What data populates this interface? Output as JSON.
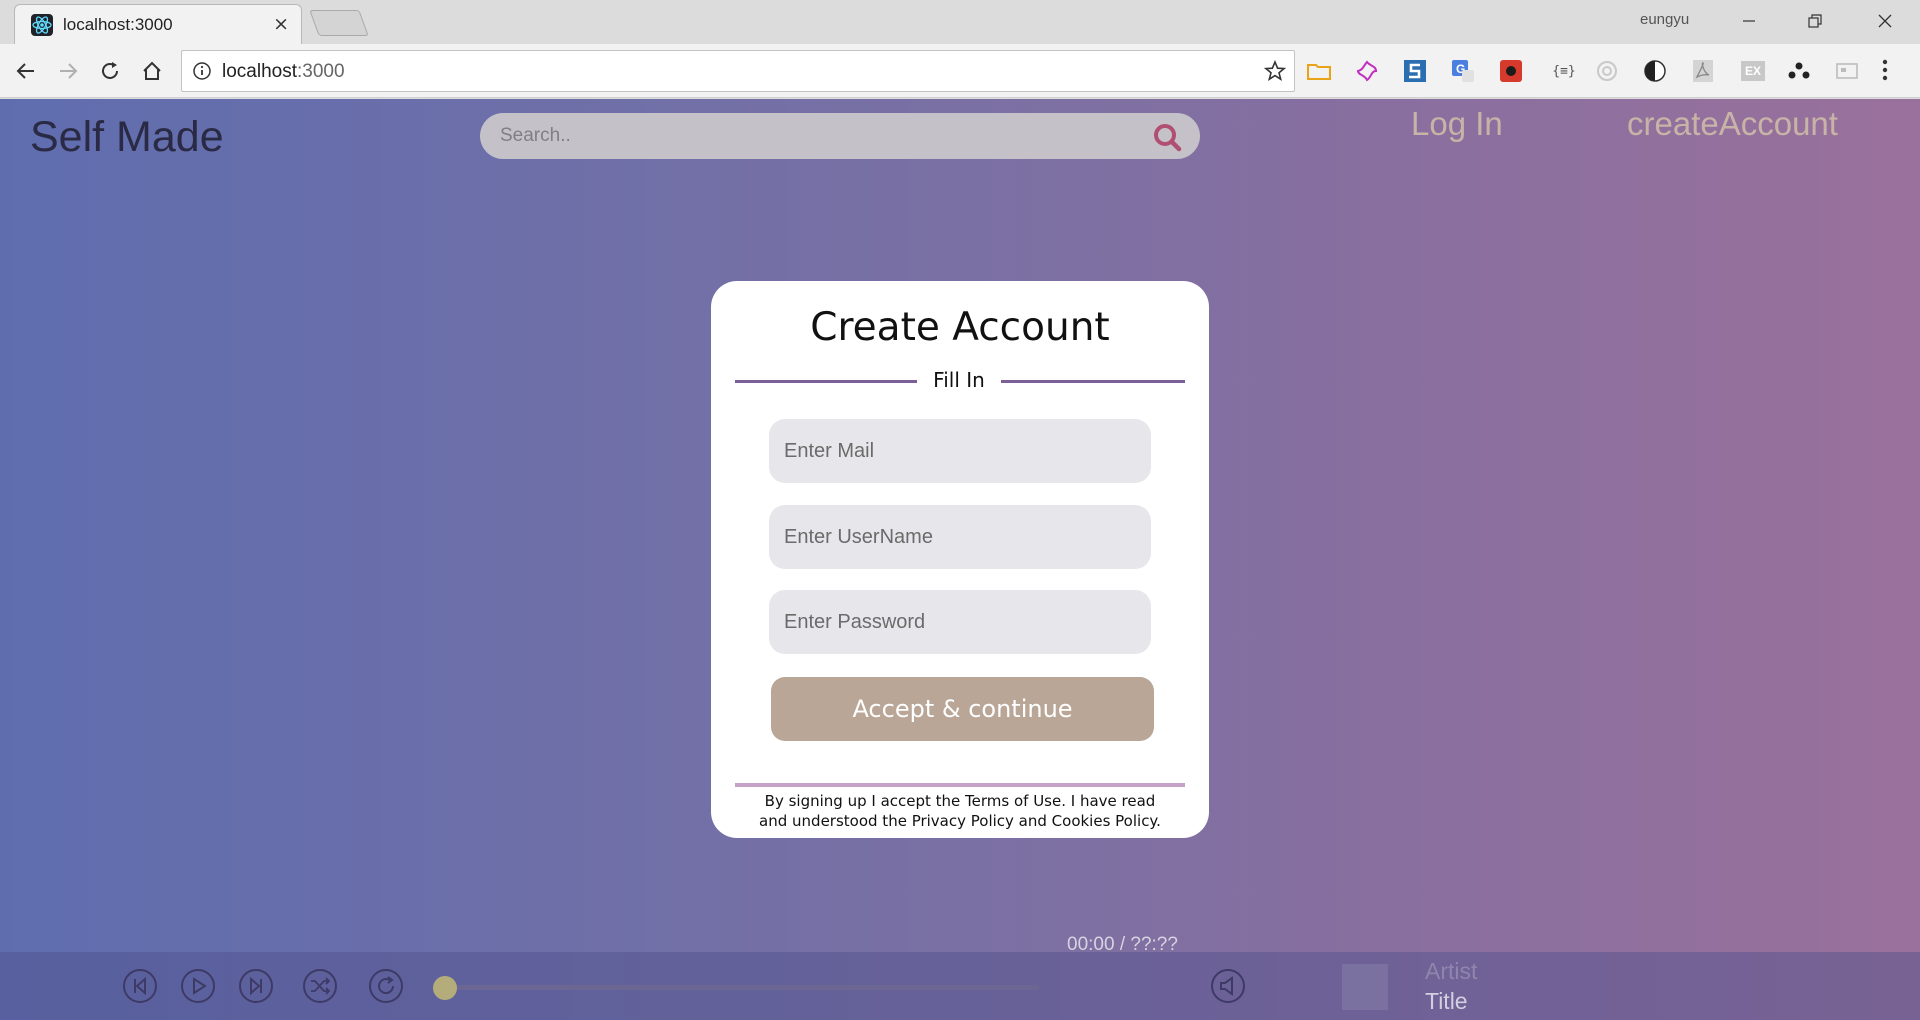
{
  "browser": {
    "tab_title": "localhost:3000",
    "tab_close": "×",
    "profile_name": "eungyu",
    "url_host": "localhost",
    "url_port": ":3000",
    "extensions": [
      "folder-icon",
      "flower-icon",
      "s-logo-icon",
      "translate-icon",
      "bug-icon",
      "json-icon",
      "target-icon",
      "contrast-icon",
      "pdf-icon",
      "ex-icon",
      "people-icon",
      "cast-icon"
    ],
    "extension_labels": {
      "json": "{≡}",
      "ex": "EX"
    }
  },
  "app": {
    "logo": "Self Made",
    "search_placeholder": "Search..",
    "nav_login": "Log In",
    "nav_create": "createAccount",
    "colors": {
      "accent": "#b9a697",
      "divider": "#7b5f96",
      "search_icon": "#b14f72"
    }
  },
  "modal": {
    "title": "Create Account",
    "divider_text": "Fill In",
    "mail_placeholder": "Enter Mail",
    "username_placeholder": "Enter UserName",
    "password_placeholder": "Enter Password",
    "accept_label": "Accept & continue",
    "terms": "By signing up I accept the Terms of Use. I have read and understood the Privacy Policy and Cookies Policy."
  },
  "player": {
    "time": "00:00 / ??:??",
    "progress": 0,
    "artist": "Artist",
    "title": "Title",
    "controls": [
      "previous-icon",
      "play-icon",
      "next-icon",
      "shuffle-icon",
      "repeat-icon",
      "volume-icon"
    ]
  }
}
